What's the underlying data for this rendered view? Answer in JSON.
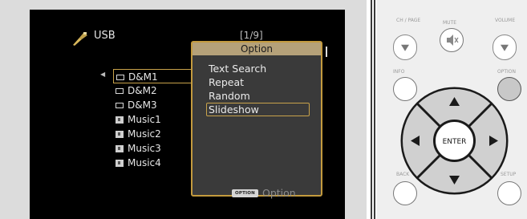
{
  "screen": {
    "source_label": "USB",
    "page_indicator": "[1/9]",
    "list": [
      {
        "label": "D&M1",
        "type": "folder",
        "selected": true
      },
      {
        "label": "D&M2",
        "type": "folder",
        "selected": false
      },
      {
        "label": "D&M3",
        "type": "folder",
        "selected": false
      },
      {
        "label": "Music1",
        "type": "music",
        "selected": false
      },
      {
        "label": "Music2",
        "type": "music",
        "selected": false
      },
      {
        "label": "Music3",
        "type": "music",
        "selected": false
      },
      {
        "label": "Music4",
        "type": "music",
        "selected": false
      }
    ],
    "popup": {
      "title": "Option",
      "items": [
        "Text Search",
        "Repeat",
        "Random",
        "Slideshow"
      ],
      "selected_index": 3
    },
    "hint": {
      "badge": "OPTION",
      "label": "Option"
    }
  },
  "remote": {
    "labels": {
      "ch_page": "CH / PAGE",
      "mute": "MUTE",
      "volume": "VOLUME",
      "info": "INFO",
      "option": "OPTION",
      "back": "BACK",
      "setup": "SETUP"
    },
    "enter_label": "ENTER"
  },
  "colors": {
    "highlight": "#c8a24a",
    "popup_title_bg": "#b5a179",
    "screen_bg": "#000000"
  }
}
